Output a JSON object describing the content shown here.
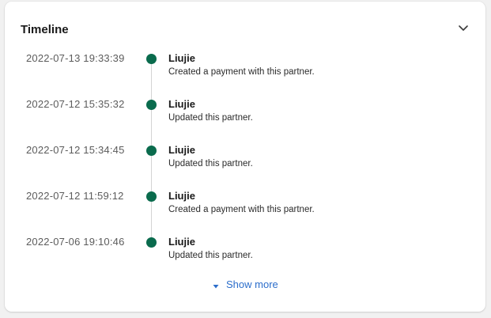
{
  "card": {
    "title": "Timeline",
    "collapse_icon": "chevron-down-icon"
  },
  "timeline": {
    "entries": [
      {
        "timestamp": "2022-07-13 19:33:39",
        "author": "Liujie",
        "description": "Created a payment with this partner."
      },
      {
        "timestamp": "2022-07-12 15:35:32",
        "author": "Liujie",
        "description": "Updated this partner."
      },
      {
        "timestamp": "2022-07-12 15:34:45",
        "author": "Liujie",
        "description": "Updated this partner."
      },
      {
        "timestamp": "2022-07-12 11:59:12",
        "author": "Liujie",
        "description": "Created a payment with this partner."
      },
      {
        "timestamp": "2022-07-06 19:10:46",
        "author": "Liujie",
        "description": "Updated this partner."
      }
    ],
    "show_more_label": "Show more",
    "show_more_icon": "caret-down-icon"
  },
  "colors": {
    "dot": "#0a6b4d",
    "link": "#2c6ecb",
    "rail": "#d4d4d4"
  }
}
